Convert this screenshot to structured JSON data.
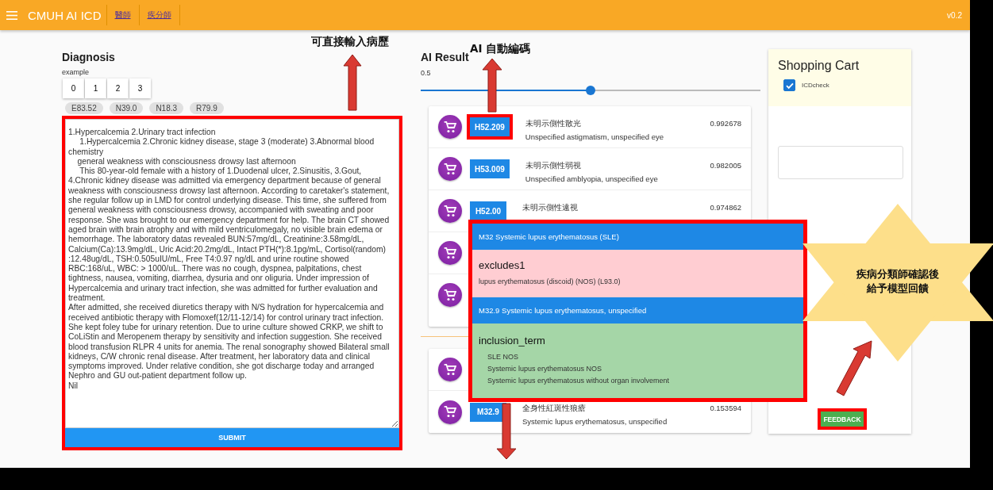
{
  "app_bar": {
    "title": "CMUH AI ICD",
    "links": [
      {
        "label": "醫師"
      },
      {
        "label": "疾分師"
      }
    ],
    "version": "v0.2"
  },
  "diagnosis": {
    "title": "Diagnosis",
    "example_label": "example",
    "example_buttons": [
      "0",
      "1",
      "2",
      "3"
    ],
    "chips": [
      "E83.52",
      "N39.0",
      "N18.3",
      "R79.9"
    ],
    "record": "1.Hypercalcemia 2.Urinary tract infection\n     1.Hypercalcemia 2.Chronic kidney disease, stage 3 (moderate) 3.Abnormal blood chemistry\n    general weakness with consciousness drowsy last afternoon\n     This 80-year-old female with a history of 1.Duodenal ulcer, 2.Sinusitis, 3.Gout, 4.Chronic kidney disease was admitted via emergency department because of general weakness with consciousness drowsy last afternoon. According to caretaker's statement, she regular follow up in LMD for control underlying disease. This time, she suffered from general weakness with consciousness drowsy, accompanied with sweating and poor response. She was brought to our emergency department for help. The brain CT showed aged brain with brain atrophy and with mild ventriculomegaly, no visible brain edema or hemorrhage. The laboratory datas revealed BUN:57mg/dL, Creatinine:3.58mg/dL, Calcium(Ca):13.9mg/dL, Uric Acid:20.2mg/dL, Intact PTH(*):8.1pg/mL, Cortisol(random) :12.48ug/dL, TSH:0.505uIU/mL, Free T4:0.97 ng/dL and urine routine showed RBC:168/uL, WBC: > 1000/uL. There was no cough, dyspnea, palpitations, chest tightness, nausea, vomiting, diarrhea, dysuria and onr oliguria. Under impression of Hypercalcemia and urinary tract infection, she was admitted for further evaluation and treatment.\nAfter admitted, she received diuretics therapy with N/S hydration for hypercalcemia and received antibiotic therapy with Flomoxef(12/11-12/14) for control urinary tract infection. She kept foley tube for urinary retention. Due to urine culture showed CRKP, we shift to CoLiStin and Meropenem therapy by sensitivity and infection suggestion. She received blood transfusion RLPR 4 units for anemia. The renal sonography showed Bilateral small kidneys, C/W chronic renal disease. After treatment, her laboratory data and clinical symptoms improved. Under relative condition, she got discharge today and arranged Nephro and GU out-patient department follow up.\nNil",
    "submit": "SUBMIT",
    "highlighted": true
  },
  "ai_result": {
    "title": "AI Result",
    "threshold": {
      "reading": "0.5",
      "level": 0.5
    },
    "groups": [
      {
        "items": [
          {
            "kind": "full",
            "code": "H52.209",
            "highlighted": true,
            "name_zh": "未明示側性散光",
            "name_en": "Unspecified astigmatism, unspecified eye",
            "score": "0.992678"
          },
          {
            "kind": "full",
            "code": "H53.009",
            "highlighted": false,
            "name_zh": "未明示側性弱視",
            "name_en": "Unspecified amblyopia, unspecified eye",
            "score": "0.982005"
          },
          {
            "kind": "full",
            "code": "H52.00",
            "highlighted": false,
            "name_zh": "未明示側性遠視",
            "score": "0.974862"
          },
          {
            "kind": "covered"
          },
          {
            "kind": "covered"
          }
        ]
      },
      {
        "items": [
          {
            "kind": "covered"
          },
          {
            "kind": "full",
            "code": "M32.9",
            "highlighted": false,
            "name_zh": "全身性紅斑性狼瘡",
            "name_en": "Systemic lupus erythematosus, unspecified",
            "score": "0.153594"
          }
        ]
      }
    ]
  },
  "code_popup": {
    "highlighted": true,
    "sections": [
      {
        "kind": "code",
        "text": "M32 Systemic lupus erythematosus (SLE)"
      },
      {
        "kind": "excludes",
        "title": "excludes1",
        "lines": [
          "lupus erythematosus (discoid) (NOS) (L93.0)"
        ]
      },
      {
        "kind": "code",
        "text": "M32.9 Systemic lupus erythematosus, unspecified"
      },
      {
        "kind": "inclusion",
        "title": "inclusion_term",
        "lines": [
          "SLE NOS",
          "Systemic lupus erythematosus NOS",
          "Systemic lupus erythematosus without organ involvement"
        ]
      }
    ]
  },
  "cart": {
    "title": "Shopping Cart",
    "check": {
      "label": "ICDcheck",
      "checked": true
    },
    "feedback": "FEEDBACK",
    "highlighted": true
  },
  "annotations": {
    "notes": [
      "可直接輸入病歷",
      "AI 自動編碼"
    ],
    "callout": [
      "疾病分類師確認後",
      "給予模型回饋"
    ]
  }
}
